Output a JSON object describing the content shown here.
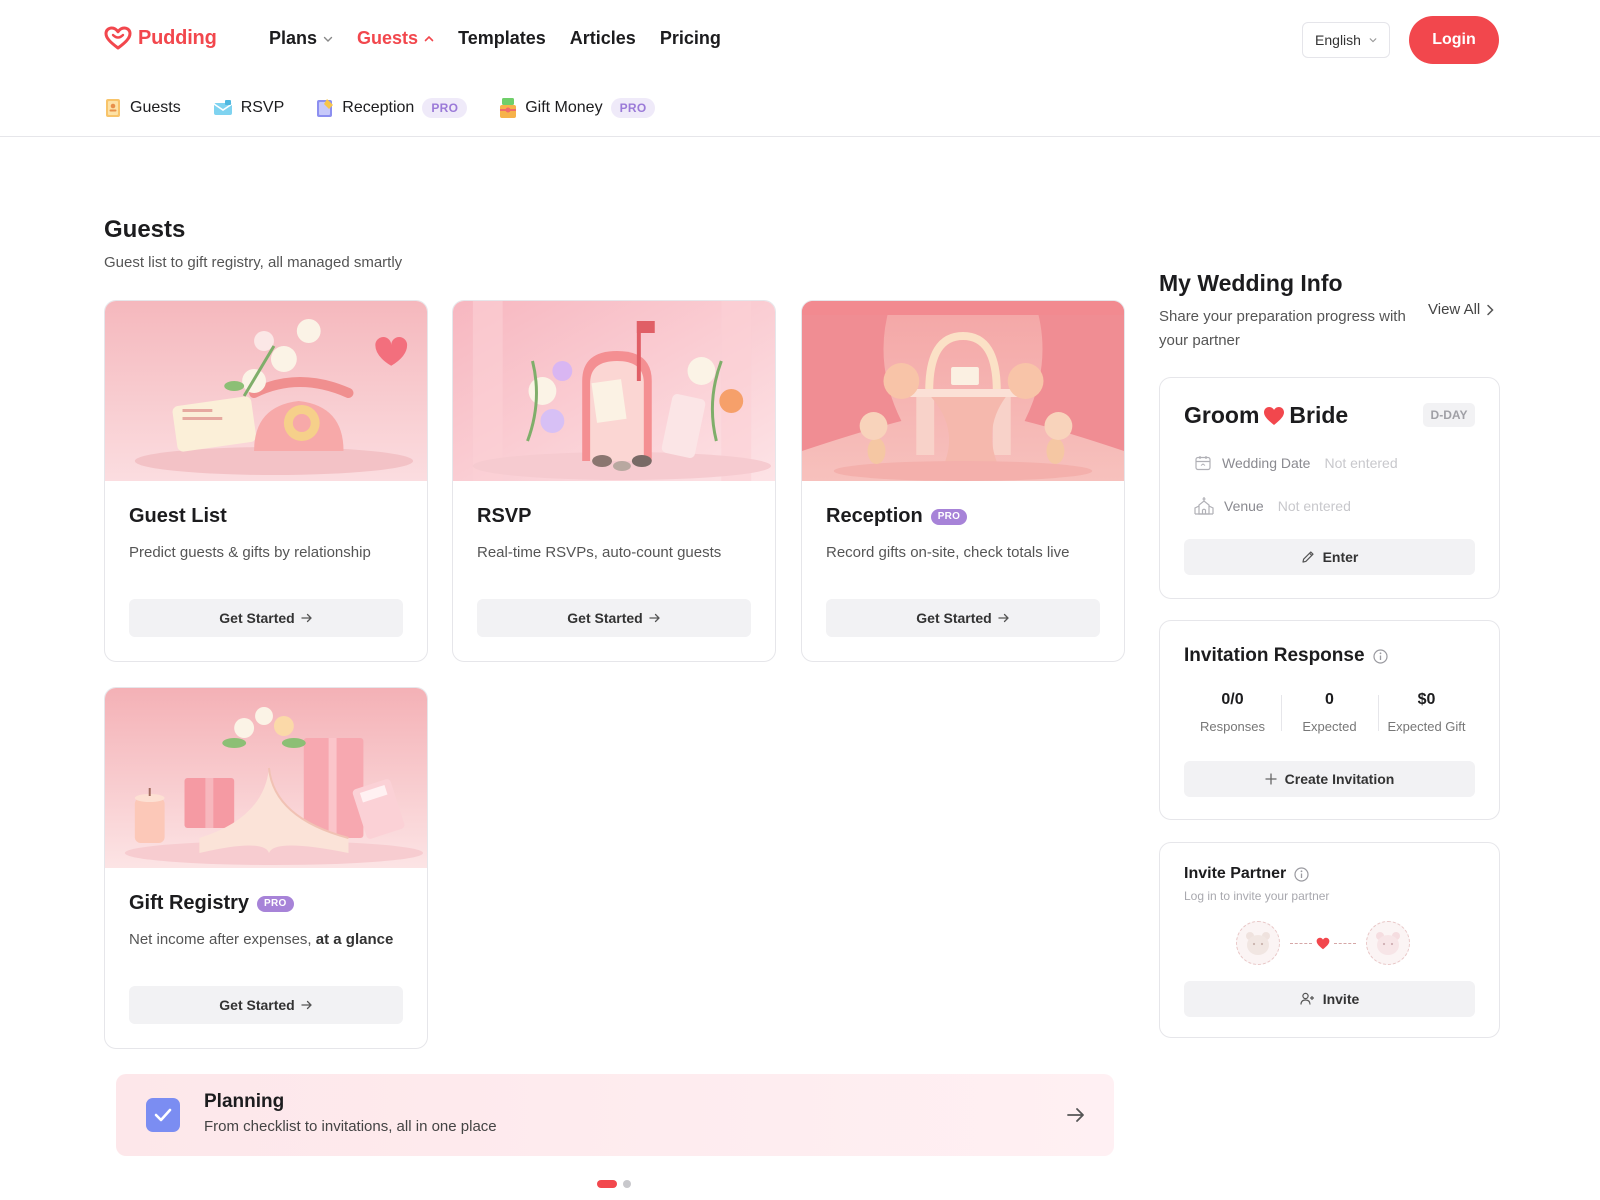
{
  "brand": {
    "name": "Pudding",
    "accent": "#f2474d",
    "pro_color": "#a783d8"
  },
  "nav": {
    "items": [
      {
        "label": "Plans",
        "has_menu": true,
        "active": false
      },
      {
        "label": "Guests",
        "has_menu": true,
        "active": true
      },
      {
        "label": "Templates",
        "has_menu": false,
        "active": false
      },
      {
        "label": "Articles",
        "has_menu": false,
        "active": false
      },
      {
        "label": "Pricing",
        "has_menu": false,
        "active": false
      }
    ],
    "language": "English",
    "login_label": "Login"
  },
  "subnav": {
    "items": [
      {
        "label": "Guests",
        "icon": "guestbook-icon"
      },
      {
        "label": "RSVP",
        "icon": "rsvp-envelope-icon"
      },
      {
        "label": "Reception",
        "icon": "reception-book-icon",
        "badge": "PRO"
      },
      {
        "label": "Gift Money",
        "icon": "gift-money-icon",
        "badge": "PRO"
      }
    ]
  },
  "section": {
    "title": "Guests",
    "subtitle": "Guest list to gift registry, all managed smartly"
  },
  "cards": [
    {
      "title": "Guest List",
      "desc": "Predict guests & gifts by relationship",
      "button": "Get Started"
    },
    {
      "title": "RSVP",
      "desc": "Real-time RSVPs, auto-count guests",
      "button": "Get Started"
    },
    {
      "title": "Reception",
      "badge": "PRO",
      "desc": "Record gifts on-site, check totals live",
      "button": "Get Started"
    },
    {
      "title": "Gift Registry",
      "badge": "PRO",
      "desc_prefix": "Net income after expenses, ",
      "desc_bold": "at a glance",
      "button": "Get Started"
    }
  ],
  "banner": {
    "title": "Planning",
    "subtitle": "From checklist to invitations, all in one place",
    "icon": "checkbox-icon"
  },
  "carousel": {
    "page": 1,
    "total": 2
  },
  "wedding_info": {
    "title": "My Wedding Info",
    "subtitle": "Share your preparation progress with your partner",
    "view_all": "View All",
    "groom": "Groom",
    "bride": "Bride",
    "dday": "D-DAY",
    "date_label": "Wedding Date",
    "date_value": "Not entered",
    "venue_label": "Venue",
    "venue_value": "Not entered",
    "enter_label": "Enter"
  },
  "invitation_response": {
    "title": "Invitation Response",
    "stats": [
      {
        "value": "0/0",
        "label": "Responses"
      },
      {
        "value": "0",
        "label": "Expected"
      },
      {
        "value": "$0",
        "label": "Expected Gift"
      }
    ],
    "create_label": "Create Invitation"
  },
  "invite_partner": {
    "title": "Invite Partner",
    "subtitle": "Log in to invite your partner",
    "invite_label": "Invite"
  }
}
